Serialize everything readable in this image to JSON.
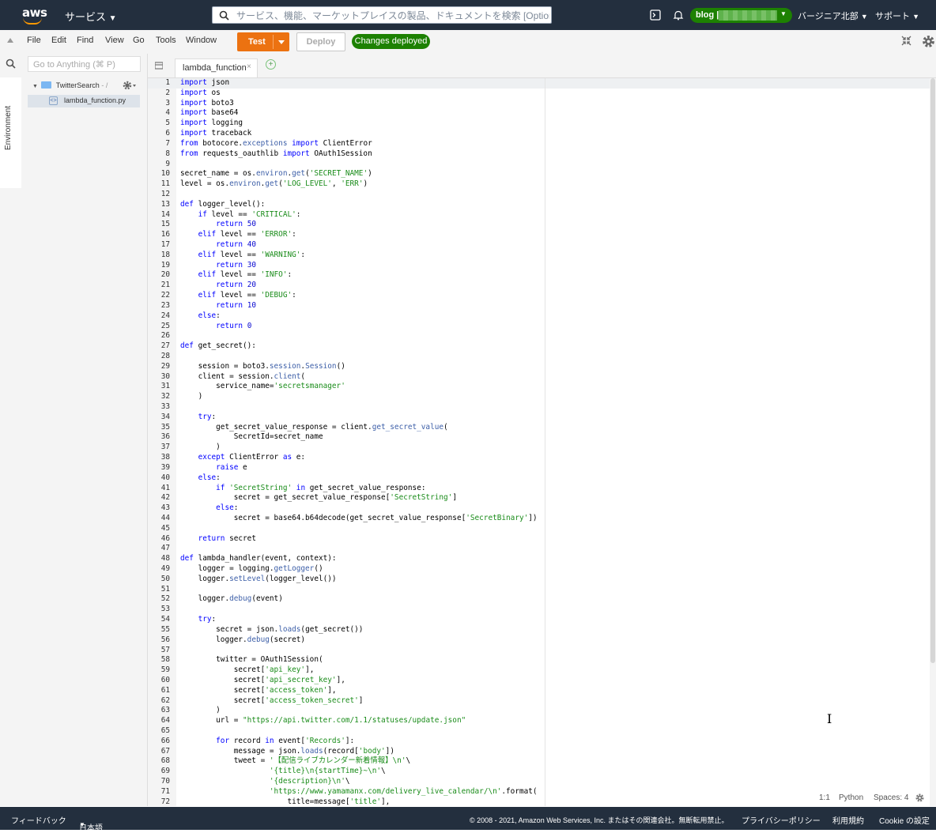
{
  "topnav": {
    "logo": "aws",
    "services_label": "サービス",
    "search_placeholder": "サービス、機能、マーケットプレイスの製品、ドキュメントを検索 [Option+S]",
    "account_label": "blog |",
    "region_label": "バージニア北部",
    "support_label": "サポート",
    "colors": {
      "nav_bg": "#232f3e",
      "brand_orange": "#ff9900",
      "success_green": "#1d8102"
    }
  },
  "menubar": {
    "items": [
      "File",
      "Edit",
      "Find",
      "View",
      "Go",
      "Tools",
      "Window"
    ],
    "test_label": "Test",
    "deploy_label": "Deploy",
    "status_label": "Changes deployed"
  },
  "sidebar": {
    "environment_label": "Environment",
    "goto_placeholder": "Go to Anything (⌘ P)",
    "root_folder": "TwitterSearch",
    "root_path": "- /",
    "file": "lambda_function.py"
  },
  "editor": {
    "tab_label": "lambda_function",
    "lines": [
      "import json",
      "import os",
      "import boto3",
      "import base64",
      "import logging",
      "import traceback",
      "from botocore.exceptions import ClientError",
      "from requests_oauthlib import OAuth1Session",
      "",
      "secret_name = os.environ.get('SECRET_NAME')",
      "level = os.environ.get('LOG_LEVEL', 'ERR')",
      "",
      "def logger_level():",
      "    if level == 'CRITICAL':",
      "        return 50",
      "    elif level == 'ERROR':",
      "        return 40",
      "    elif level == 'WARNING':",
      "        return 30",
      "    elif level == 'INFO':",
      "        return 20",
      "    elif level == 'DEBUG':",
      "        return 10",
      "    else:",
      "        return 0",
      "",
      "def get_secret():",
      "",
      "    session = boto3.session.Session()",
      "    client = session.client(",
      "        service_name='secretsmanager'",
      "    )",
      "",
      "    try:",
      "        get_secret_value_response = client.get_secret_value(",
      "            SecretId=secret_name",
      "        )",
      "    except ClientError as e:",
      "        raise e",
      "    else:",
      "        if 'SecretString' in get_secret_value_response:",
      "            secret = get_secret_value_response['SecretString']",
      "        else:",
      "            secret = base64.b64decode(get_secret_value_response['SecretBinary'])",
      "",
      "    return secret",
      "",
      "def lambda_handler(event, context):",
      "    logger = logging.getLogger()",
      "    logger.setLevel(logger_level())",
      "",
      "    logger.debug(event)",
      "",
      "    try:",
      "        secret = json.loads(get_secret())",
      "        logger.debug(secret)",
      "",
      "        twitter = OAuth1Session(",
      "            secret['api_key'],",
      "            secret['api_secret_key'],",
      "            secret['access_token'],",
      "            secret['access_token_secret']",
      "        )",
      "        url = \"https://api.twitter.com/1.1/statuses/update.json\"",
      "",
      "        for record in event['Records']:",
      "            message = json.loads(record['body'])",
      "            tweet = '【配信ライブカレンダー新着情報】\\n'\\",
      "                    '{title}\\n{startTime}~\\n'\\",
      "                    '{description}\\n'\\",
      "                    'https://www.yamamanx.com/delivery_live_calendar/\\n'.format(",
      "                        title=message['title'],"
    ]
  },
  "statusbar": {
    "position": "1:1",
    "language": "Python",
    "spaces": "Spaces: 4"
  },
  "footer": {
    "feedback": "フィードバック",
    "language": "日本語",
    "copyright": "© 2008 - 2021, Amazon Web Services, Inc. またはその関連会社。無断転用禁止。",
    "privacy": "プライバシーポリシー",
    "terms": "利用規約",
    "cookie": "Cookie の設定"
  }
}
